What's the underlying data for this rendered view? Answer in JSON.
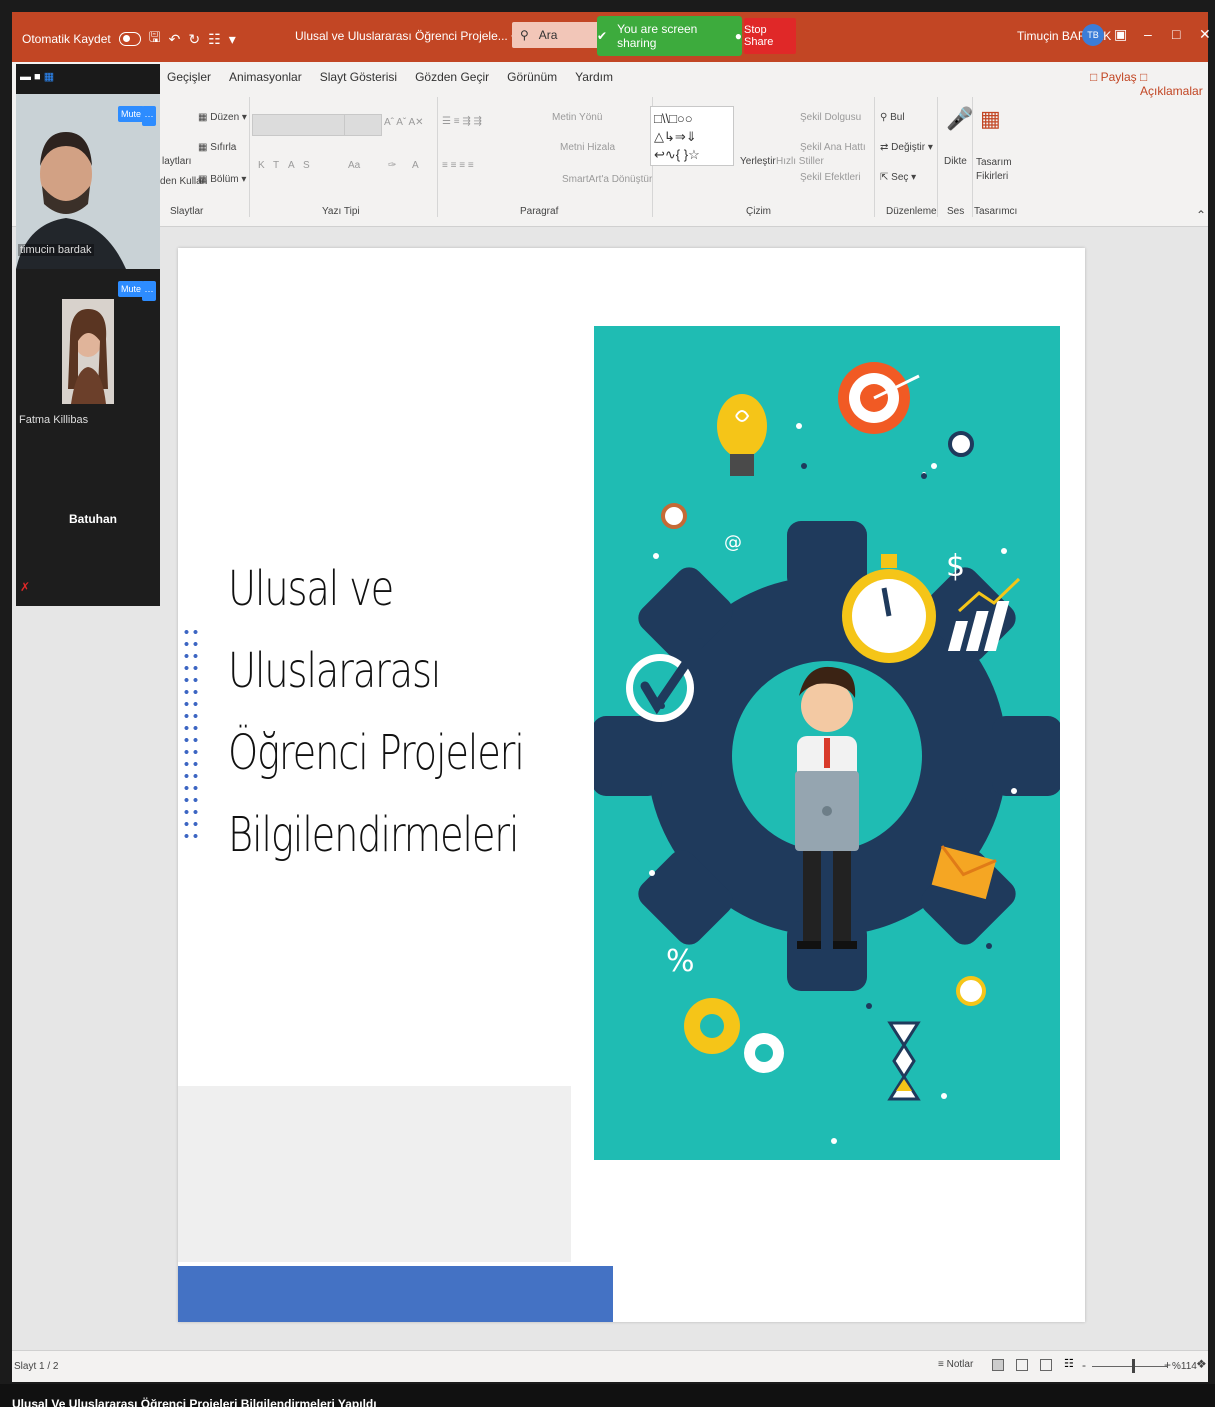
{
  "titlebar": {
    "autosave_label": "Otomatik Kaydet",
    "doc_title": "Ulusal ve Uluslararası Öğrenci Projele... •",
    "search_placeholder": "Ara",
    "share_status": "You are screen sharing",
    "stop_share_label": "Stop Share",
    "user_name": "Timuçin BARDAK",
    "user_initials": "TB",
    "accent_color": "#c24624"
  },
  "ribbon": {
    "tabs": [
      "Geçişler",
      "Animasyonlar",
      "Slayt Gösterisi",
      "Gözden Geçir",
      "Görünüm",
      "Yardım"
    ],
    "share_label": "Paylaş",
    "comments_label": "Açıklamalar",
    "slides_group": {
      "label": "Slaytlar",
      "items": [
        "Düzen",
        "Sıfırla",
        "Bölüm"
      ],
      "partial_lines": [
        "laytları",
        "den Kullan"
      ]
    },
    "font_group": {
      "label": "Yazı Tipi",
      "buttons": [
        "K",
        "T",
        "A",
        "S",
        "Aa"
      ]
    },
    "paragraph_group": {
      "label": "Paragraf",
      "items": [
        "Metin Yönü",
        "Metni Hizala",
        "SmartArt'a Dönüştür"
      ]
    },
    "drawing_group": {
      "label": "Çizim",
      "items": [
        "Şekil Dolgusu",
        "Şekil Ana Hattı",
        "Şekil Efektleri"
      ],
      "arrange_label": "Yerleştir",
      "quick_styles_label": "Hızlı Stiller"
    },
    "editing_group": {
      "label": "Düzenleme",
      "items": [
        "Bul",
        "Değiştir",
        "Seç"
      ]
    },
    "voice_group": {
      "label": "Ses",
      "button": "Dikte"
    },
    "designer_group": {
      "label": "Tasarımcı",
      "button": "Tasarım Fikirleri"
    }
  },
  "slide": {
    "title_lines": [
      "Ulusal ve",
      "Uluslararası",
      "Öğrenci Projeleri",
      "Bilgilendirmeleri"
    ],
    "illustration_bg": "#1fbcb3",
    "blue_bar_color": "#4472c4"
  },
  "zoom": {
    "participants": [
      {
        "name": "timucin bardak",
        "mute": "Mute"
      },
      {
        "name": "Fatma Killibas",
        "mute": "Mute"
      },
      {
        "name": "Batuhan"
      }
    ]
  },
  "statusbar": {
    "slide_count": "Slayt 1 / 2",
    "notes_label": "Notlar",
    "zoom_level": "%114",
    "zoom_fraction": 0.55
  },
  "bottom_text": "Ulusal Ve Uluslararası Öğrenci Projeleri Bilgilendirmeleri Yapıldı"
}
